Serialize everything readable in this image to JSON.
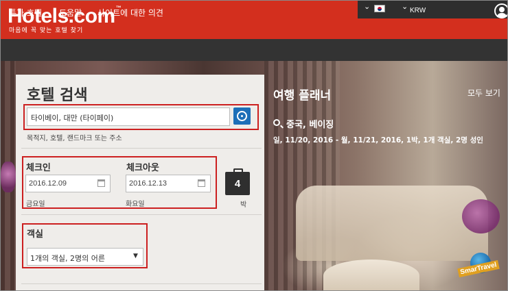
{
  "header": {
    "logo": "Hotels.com",
    "logo_tm": "™",
    "tagline": "마음에 꼭 맞는 호텔 찾기",
    "currency": "KRW",
    "flag_icon": "korea-flag-icon"
  },
  "nav": {
    "items": [
      "특가 호텔",
      "도움말",
      "사이트에 대한 의견"
    ],
    "user_icon": "user-icon"
  },
  "search": {
    "title": "호텔 검색",
    "destination_value": "타이베이, 대만 (타이페이)",
    "destination_hint": "목적지, 호텔, 랜드마크 또는 주소",
    "checkin_label": "체크인",
    "checkin_value": "2016.12.09",
    "checkin_dow": "금요일",
    "checkout_label": "체크아웃",
    "checkout_value": "2016.12.13",
    "checkout_dow": "화요일",
    "nights_count": "4",
    "nights_label": "박",
    "rooms_label": "객실",
    "rooms_value": "1개의 객실, 2명의 어른"
  },
  "planner": {
    "title": "여행 플래너",
    "view_all": "모두 보기",
    "recent_destination": "중국, 베이징",
    "recent_detail": "일, 11/20, 2016 - 월, 11/21, 2016, 1박, 1개 객실, 2명 성인"
  },
  "badge": {
    "text": "SmarTravel"
  },
  "colors": {
    "brand_red": "#d32f1e",
    "nav_dark": "#333333",
    "accent_blue": "#1d6fb8",
    "highlight_red": "#cc1f1f"
  }
}
